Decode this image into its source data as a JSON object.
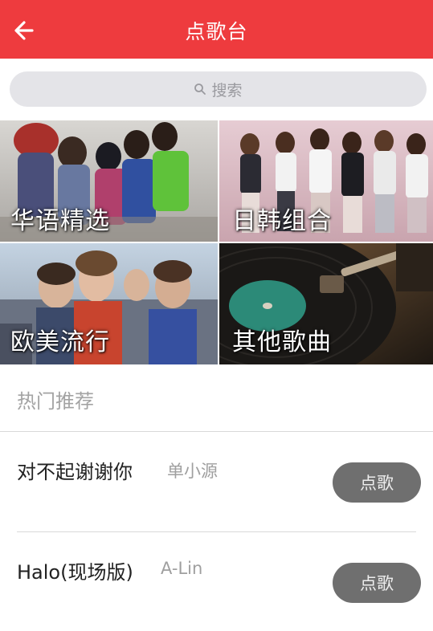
{
  "header": {
    "title": "点歌台",
    "back_icon": "arrow-left-icon"
  },
  "search": {
    "placeholder": "搜索",
    "icon": "search-icon"
  },
  "categories": [
    {
      "label": "华语精选"
    },
    {
      "label": "日韩组合"
    },
    {
      "label": "欧美流行"
    },
    {
      "label": "其他歌曲"
    }
  ],
  "section": {
    "title": "热门推荐"
  },
  "songs": [
    {
      "title": "对不起谢谢你",
      "artist": "单小源",
      "button": "点歌"
    },
    {
      "title": "Halo(现场版)",
      "artist": "A-Lin",
      "button": "点歌"
    }
  ],
  "colors": {
    "brand": "#ee3b3e",
    "button": "#6f6f6f",
    "muted_text": "#a3a3a3"
  }
}
